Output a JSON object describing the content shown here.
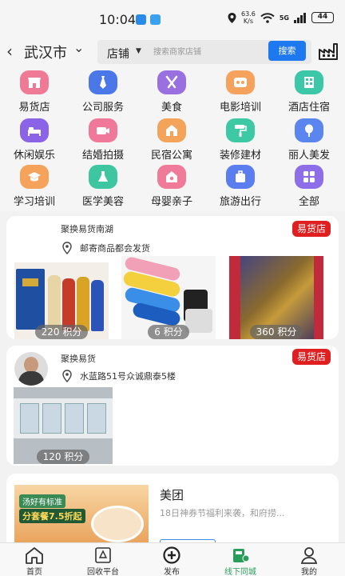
{
  "status": {
    "time": "10:04",
    "net_speed_value": "63.6",
    "net_speed_unit": "K/s",
    "network": "5G",
    "battery": "44"
  },
  "header": {
    "city": "武汉市",
    "search_type": "店铺",
    "search_placeholder": "搜索商家店铺",
    "search_button": "搜索"
  },
  "categories": [
    {
      "label": "易货店",
      "icon": "shop-icon",
      "color": "#f07a95"
    },
    {
      "label": "公司服务",
      "icon": "tie-icon",
      "color": "#4a78e8"
    },
    {
      "label": "美食",
      "icon": "utensils-icon",
      "color": "#9a6fe0"
    },
    {
      "label": "电影培训",
      "icon": "film-icon",
      "color": "#f5a25c"
    },
    {
      "label": "酒店住宿",
      "icon": "hotel-icon",
      "color": "#3bc7a8"
    },
    {
      "label": "休闲娱乐",
      "icon": "bed-icon",
      "color": "#8a63e6"
    },
    {
      "label": "结婚拍摄",
      "icon": "camera-icon",
      "color": "#f0799a"
    },
    {
      "label": "民宿公寓",
      "icon": "house-icon",
      "color": "#f4a35a"
    },
    {
      "label": "装修建材",
      "icon": "paint-roller-icon",
      "color": "#3cc9a4"
    },
    {
      "label": "丽人美发",
      "icon": "mirror-icon",
      "color": "#5b86f0"
    },
    {
      "label": "学习培训",
      "icon": "graduation-icon",
      "color": "#f5a35b"
    },
    {
      "label": "医学美容",
      "icon": "flask-icon",
      "color": "#3ec6a0"
    },
    {
      "label": "母婴亲子",
      "icon": "baby-house-icon",
      "color": "#f07b98"
    },
    {
      "label": "旅游出行",
      "icon": "suitcase-icon",
      "color": "#5a7ef0"
    },
    {
      "label": "全部",
      "icon": "grid-icon",
      "color": "#8e6ee8"
    }
  ],
  "cards": [
    {
      "title": "聚换易货南湖",
      "badge": "易货店",
      "address": "邮寄商品都会发货",
      "products": [
        {
          "points": "220 积分"
        },
        {
          "points": "6 积分"
        },
        {
          "points": "360 积分"
        }
      ]
    },
    {
      "title": "聚换易货",
      "badge": "易货店",
      "address": "水蓝路51号众诚鼎泰5楼",
      "products": [
        {
          "points": "120 积分"
        }
      ]
    }
  ],
  "promo": {
    "title": "美团",
    "subtitle": "18日神券节福利来袭，和府捞...",
    "image_text": "分套餐7.5折起",
    "image_banner": "汤好有标准"
  },
  "tabs": [
    {
      "label": "首页",
      "icon": "home-icon"
    },
    {
      "label": "回收平台",
      "icon": "recycle-icon"
    },
    {
      "label": "发布",
      "icon": "plus-circle-icon"
    },
    {
      "label": "线下同城",
      "icon": "store-pin-icon",
      "active": true
    },
    {
      "label": "我的",
      "icon": "user-icon"
    }
  ]
}
